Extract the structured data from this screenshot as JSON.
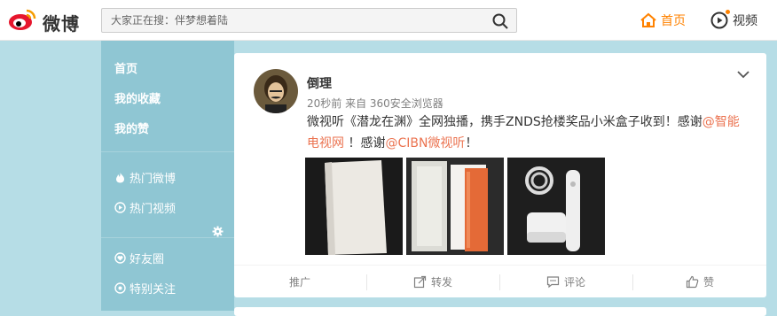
{
  "brand": {
    "name": "微博"
  },
  "search": {
    "placeholder": "大家正在搜：伴梦想着陆"
  },
  "topnav": {
    "home": "首页",
    "video": "视频"
  },
  "leftnav": {
    "main": [
      "首页",
      "我的收藏",
      "我的赞"
    ],
    "group1": [
      "热门微博",
      "热门视频"
    ],
    "group2": [
      "好友圈",
      "特别关注"
    ]
  },
  "post": {
    "author": "倒理",
    "meta": "20秒前 来自 360安全浏览器",
    "text_part1": "微视听《潜龙在渊》全网独播，携手ZNDS抢楼奖品小米盒子收到！感谢",
    "mention1": "@智能电视网",
    "text_part2": " ！感谢",
    "mention2": "@CIBN微视听",
    "text_part3": "！"
  },
  "actions": {
    "promote": "推广",
    "repost": "转发",
    "comment": "评论",
    "like": "赞"
  },
  "colors": {
    "accent": "#ff8200",
    "link": "#eb7350",
    "nav_bg": "#8fc6d3",
    "page_bg": "#b6dde6"
  }
}
